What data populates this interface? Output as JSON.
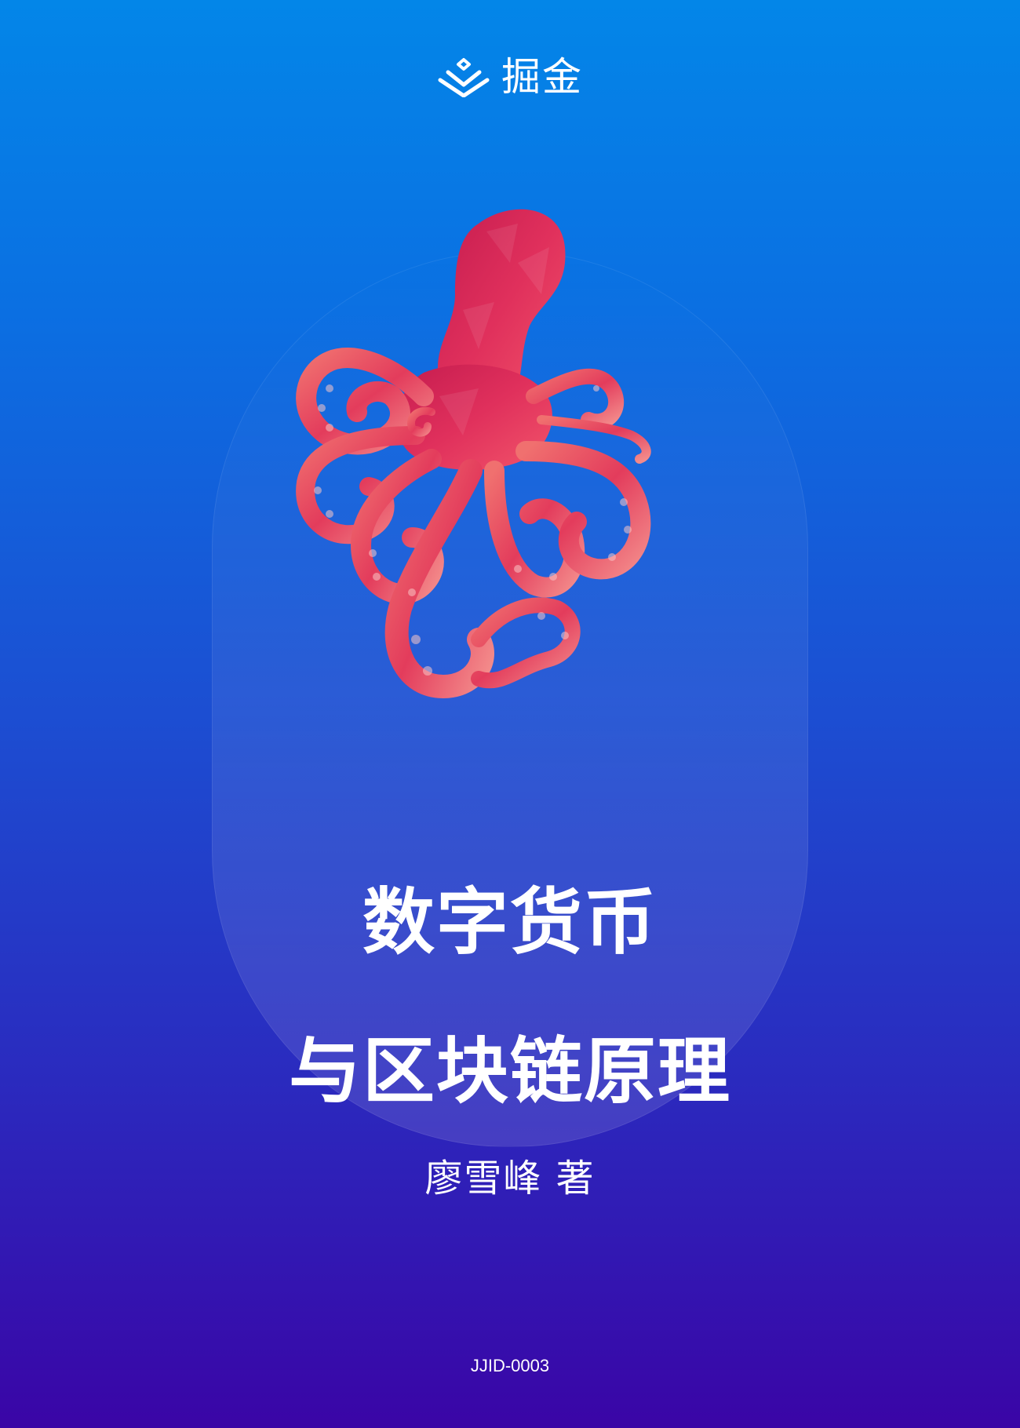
{
  "brand": {
    "logo_text": "掘金",
    "icon": "juejin-logo-icon"
  },
  "book": {
    "title_line1": "数字货币",
    "title_line2": "与区块链原理",
    "author": "廖雪峰 著",
    "code": "JJID-0003"
  },
  "illustration": {
    "subject": "octopus-illustration",
    "color": "#e03a5f"
  },
  "colors": {
    "background_top": "#0386e8",
    "background_bottom": "#3a05a6",
    "text": "#ffffff"
  }
}
